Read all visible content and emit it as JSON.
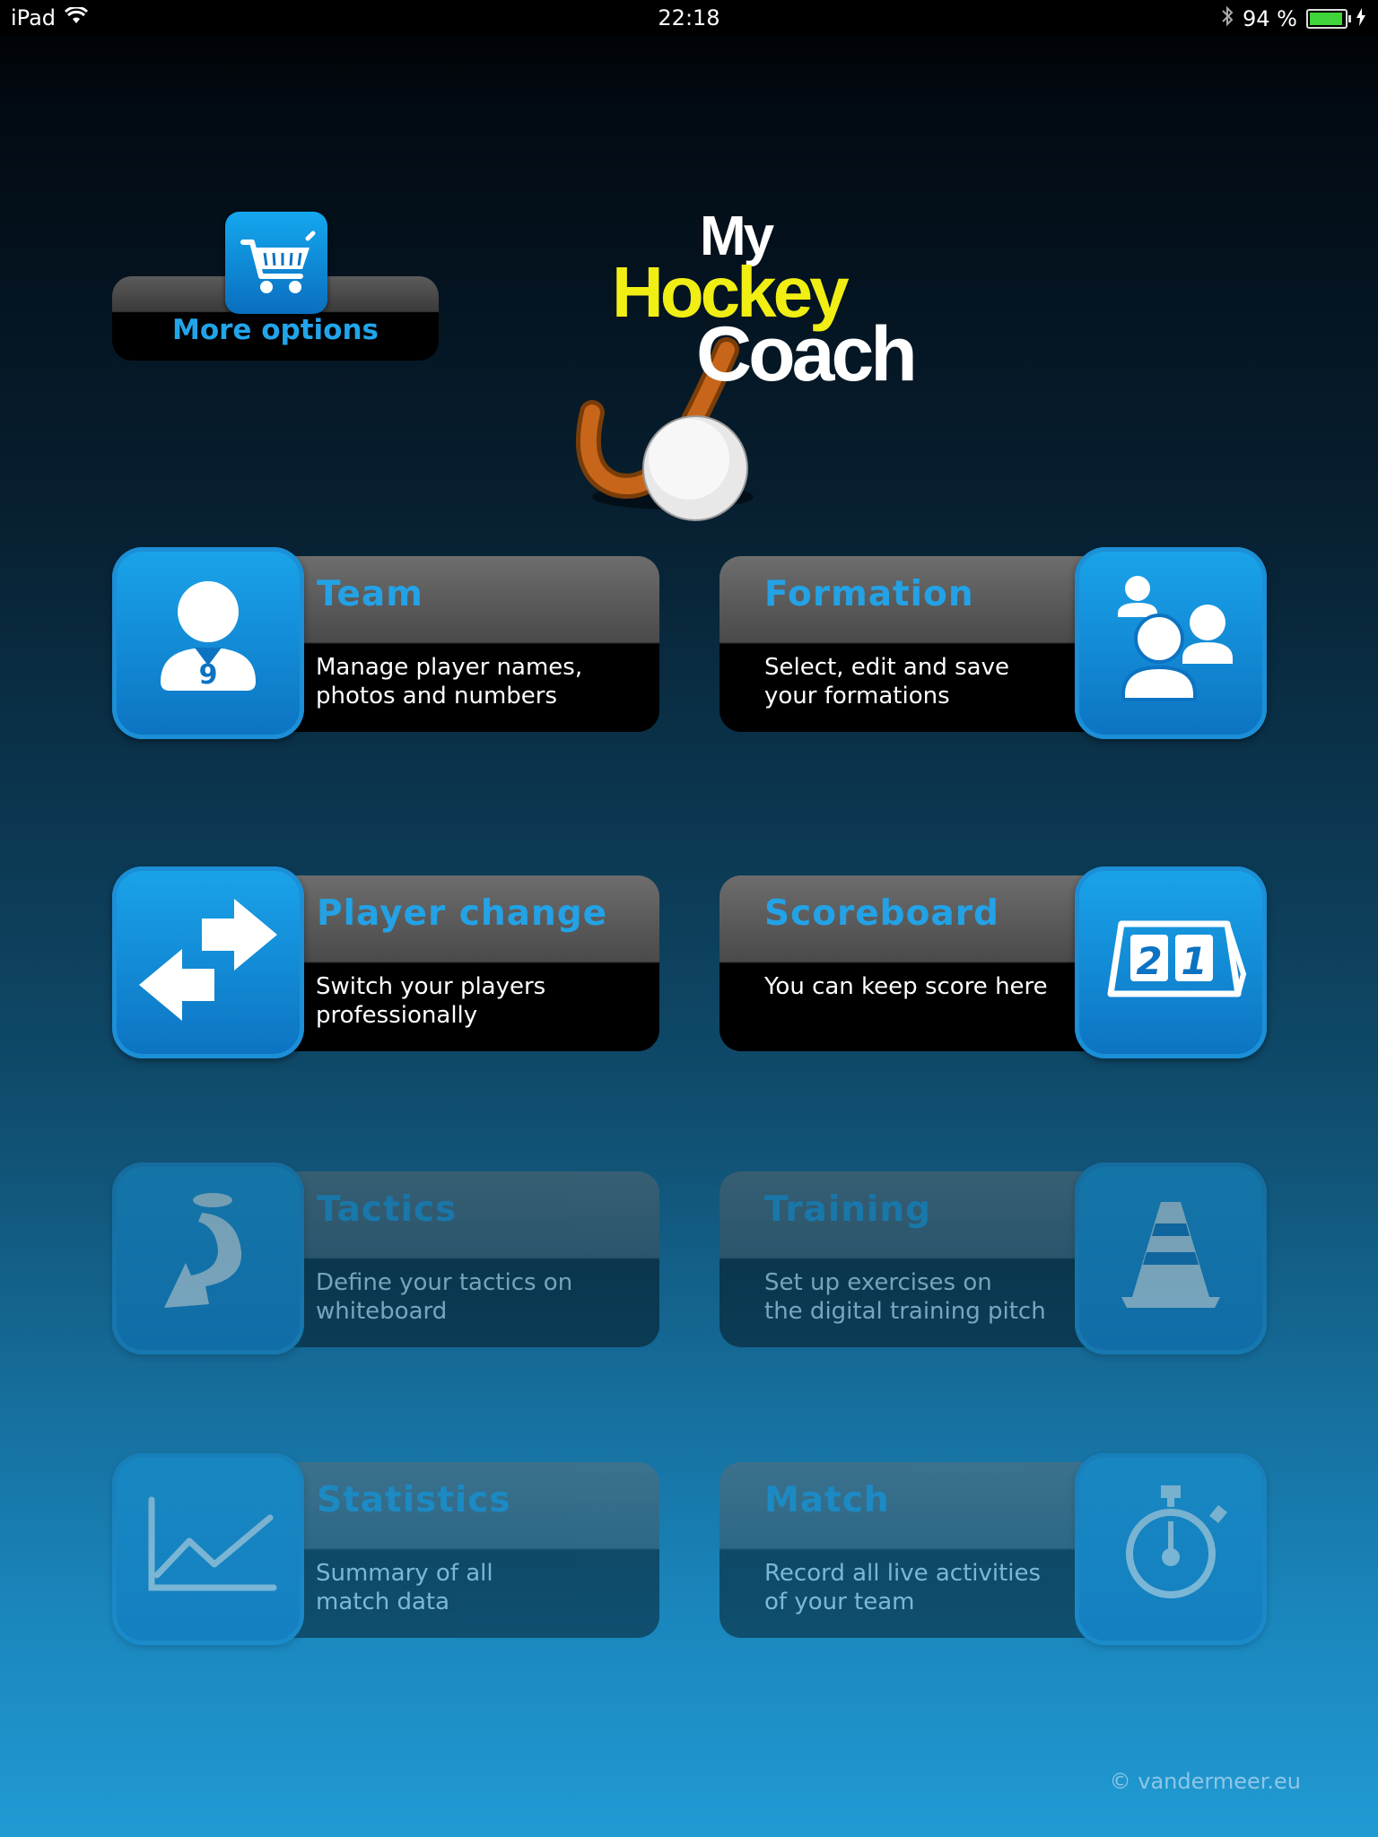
{
  "status_bar": {
    "device": "iPad",
    "time": "22:18",
    "battery": "94 %",
    "battery_level": 0.94,
    "icons": [
      "wifi-icon",
      "bluetooth-icon",
      "battery-icon",
      "charging-icon"
    ]
  },
  "more_options": {
    "label": "More options",
    "icon": "shopping-cart-icon"
  },
  "logo": {
    "line1": "My",
    "line2": "Hockey",
    "line3": "Coach"
  },
  "tiles": [
    {
      "title": "Team",
      "description": "Manage player names,\nphotos and numbers",
      "icon": "player-icon",
      "badge": "9"
    },
    {
      "title": "Formation",
      "description": "Select, edit and save\nyour formations",
      "icon": "group-icon"
    },
    {
      "title": "Player change",
      "description": "Switch your players\nprofessionally",
      "icon": "swap-arrows-icon"
    },
    {
      "title": "Scoreboard",
      "description": "You can keep score here",
      "icon": "scoreboard-icon",
      "score_left": "2",
      "score_right": "1"
    },
    {
      "title": "Tactics",
      "description": "Define your tactics on\nwhiteboard",
      "icon": "tactics-arrow-icon"
    },
    {
      "title": "Training",
      "description": "Set up exercises on\nthe digital training pitch",
      "icon": "cone-icon"
    },
    {
      "title": "Statistics",
      "description": "Summary of all\nmatch data",
      "icon": "line-chart-icon"
    },
    {
      "title": "Match",
      "description": "Record all live activities\nof your team",
      "icon": "stopwatch-icon"
    }
  ],
  "footer": {
    "copyright": "© vandermeer.eu"
  },
  "colors": {
    "accent": "#23a2e6",
    "logo_yellow": "#f1ee14",
    "tile_icon": "#0c73c2"
  }
}
